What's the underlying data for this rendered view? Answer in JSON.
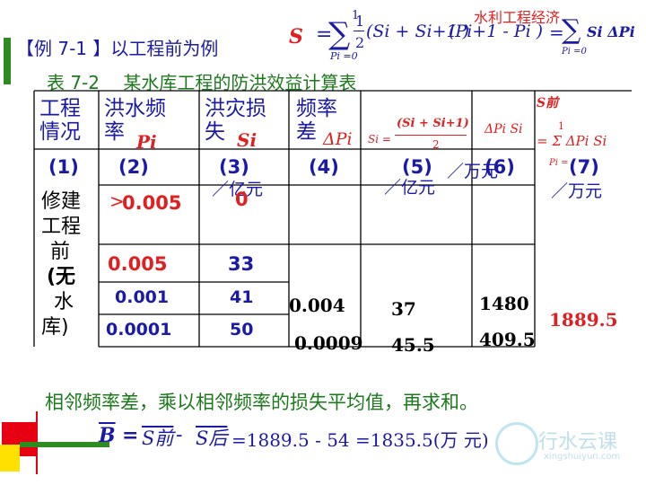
{
  "watermark_top": "水利工程经济",
  "example_title": "【例 7-1 】以工程前为例",
  "formula_top": {
    "lhs": "S",
    "eq": "=",
    "sum_top": "1",
    "sum_bottom": "Pi =0",
    "frac_num": "1",
    "frac_den": "2",
    "paren1": "(Si + Si+1 )",
    "paren2": "(Pi+1 - Pi )",
    "eq2": "=",
    "sum2_bottom": "Pi =0",
    "rhs": "Si ΔPi"
  },
  "table_caption": "表 7-2　 某水库工程的防洪效益计算表",
  "headers": {
    "col1": [
      "工程",
      "情况"
    ],
    "col2": [
      "洪水频",
      "率"
    ],
    "col2_sym": "Pi",
    "col3": [
      "洪灾损",
      "失"
    ],
    "col3_sym": "Si",
    "col4": [
      "频率",
      "差"
    ],
    "col4_sym": "ΔPi",
    "col5_formula_lhs": "Si =",
    "col5_formula_num": "(Si + Si+1)",
    "col5_formula_den": "2",
    "col6_formula": "ΔPi Si",
    "col7_top": "S前",
    "col7_formula": "= Σ ΔPi Si",
    "col7_sum_top": "1",
    "col7_sum_bottom": "Pi ="
  },
  "index_row": [
    "(1)",
    "(2)",
    "(3)",
    "(4)",
    "(5)",
    "(6)",
    "(7)"
  ],
  "units": {
    "col3": "／亿元",
    "col5": "／亿元",
    "col6": "／万元",
    "col7": "／万元"
  },
  "row_label": [
    "修建",
    "工程",
    "前",
    "(无",
    "水",
    "库)"
  ],
  "rows": [
    {
      "p": "0.005",
      "p_prefix": ">",
      "s": "0",
      "style": "red"
    },
    {
      "p": "0.005",
      "s": "33",
      "style": "red"
    },
    {
      "p": "0.001",
      "s": "41",
      "style": "blue"
    },
    {
      "p": "0.0001",
      "s": "50",
      "style": "blue"
    }
  ],
  "values": {
    "dp1": "0.004",
    "dp2": "0.0009",
    "sbar1": "37",
    "sbar2": "45.5",
    "prod1": "1480",
    "prod2": "409.5",
    "total": "1889.5"
  },
  "bottom_sentence": "相邻频率差，乘以相邻频率的损失平均值，再求和。",
  "bottom_formula": {
    "lhs": "B",
    "eq": "=",
    "s1": "S前",
    "minus": "-",
    "s2": "S后",
    "result": "=1889.5 - 54 =1835.5(万 元)"
  },
  "logo": {
    "text": "行水云课",
    "url": "xingshuiyun.com"
  },
  "colors": {
    "blue": "#1a1aa6",
    "red": "#e02020",
    "green": "#1c7a1c",
    "bar_red": "#e60012",
    "bar_yellow": "#ffe100",
    "bar_green": "#2e8b22"
  }
}
